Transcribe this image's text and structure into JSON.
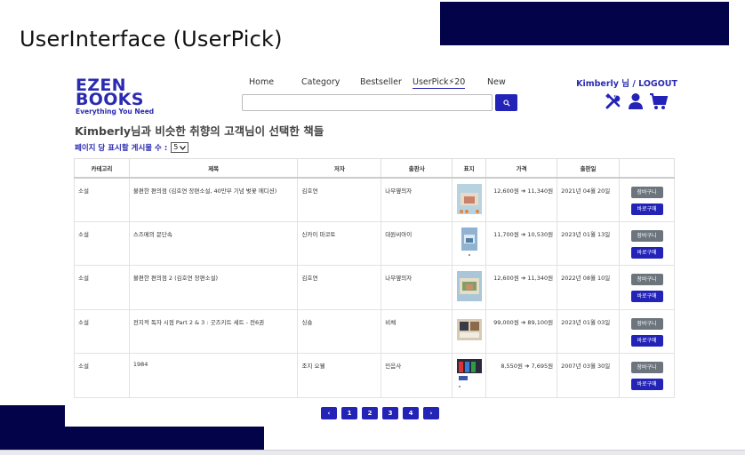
{
  "slide": {
    "title": "UserInterface (UserPick)"
  },
  "logo": {
    "line1": "EZEN",
    "line2": "BOOKS",
    "tagline": "Everything You Need"
  },
  "nav": {
    "items": [
      "Home",
      "Category",
      "Bestseller",
      "UserPick⚡20",
      "New"
    ],
    "active": "UserPick⚡20"
  },
  "search": {
    "value": "",
    "placeholder": ""
  },
  "user": {
    "name": "Kimberly 님",
    "separator": " / ",
    "logout": "LOGOUT"
  },
  "icons": [
    "tools-icon",
    "user-icon",
    "cart-icon"
  ],
  "page": {
    "heading": "Kimberly님과 비슷한 취향의 고객님이 선택한 책들",
    "per_page_label": "페이지 당 표시할 게시물 수 :",
    "per_page_value": "5"
  },
  "table": {
    "headers": [
      "카테고리",
      "제목",
      "저자",
      "출판사",
      "표지",
      "가격",
      "출판일",
      ""
    ],
    "rows": [
      {
        "category": "소설",
        "title": "불편한 편의점 (김호연 장편소설, 40만부 기념 벚꽃 에디션)",
        "author": "김호연",
        "publisher": "나무옆의자",
        "price": "12,600원  ➔ 11,340원",
        "date": "2021년 04월 20일",
        "cover_color": "#b8d3e0"
      },
      {
        "category": "소설",
        "title": "스즈메의 문단속",
        "author": "신카이 마코토",
        "publisher": "대원씨아이",
        "price": "11,700원  ➔ 10,530원",
        "date": "2023년 01월 13일",
        "cover_color": "#8fb3d1"
      },
      {
        "category": "소설",
        "title": "불편한 편의점 2 (김호연 장편소설)",
        "author": "김호연",
        "publisher": "나무옆의자",
        "price": "12,600원  ➔ 11,340원",
        "date": "2022년 08월 10일",
        "cover_color": "#a9c7d8"
      },
      {
        "category": "소설",
        "title": "전지적 독자 시점 Part 2 & 3 : 굿즈키트 세트 - 전6권",
        "author": "싱숑",
        "publisher": "비채",
        "price": "99,000원  ➔ 89,100원",
        "date": "2023년 01월 03일",
        "cover_color": "#d8cbb5"
      },
      {
        "category": "소설",
        "title": "1984",
        "author": "조지 오웰",
        "publisher": "민음사",
        "price": "8,550원  ➔ 7,695원",
        "date": "2007년 03월 30일",
        "cover_color": "#2a2a3a"
      }
    ],
    "cart_label": "장바구니",
    "buy_label": "바로구매"
  },
  "pagination": {
    "prev": "‹",
    "pages": [
      "1",
      "2",
      "3",
      "4"
    ],
    "next": "›"
  },
  "colors": {
    "brand": "#2323b8",
    "deco": "#03034a",
    "cart_button": "#6c757d"
  }
}
